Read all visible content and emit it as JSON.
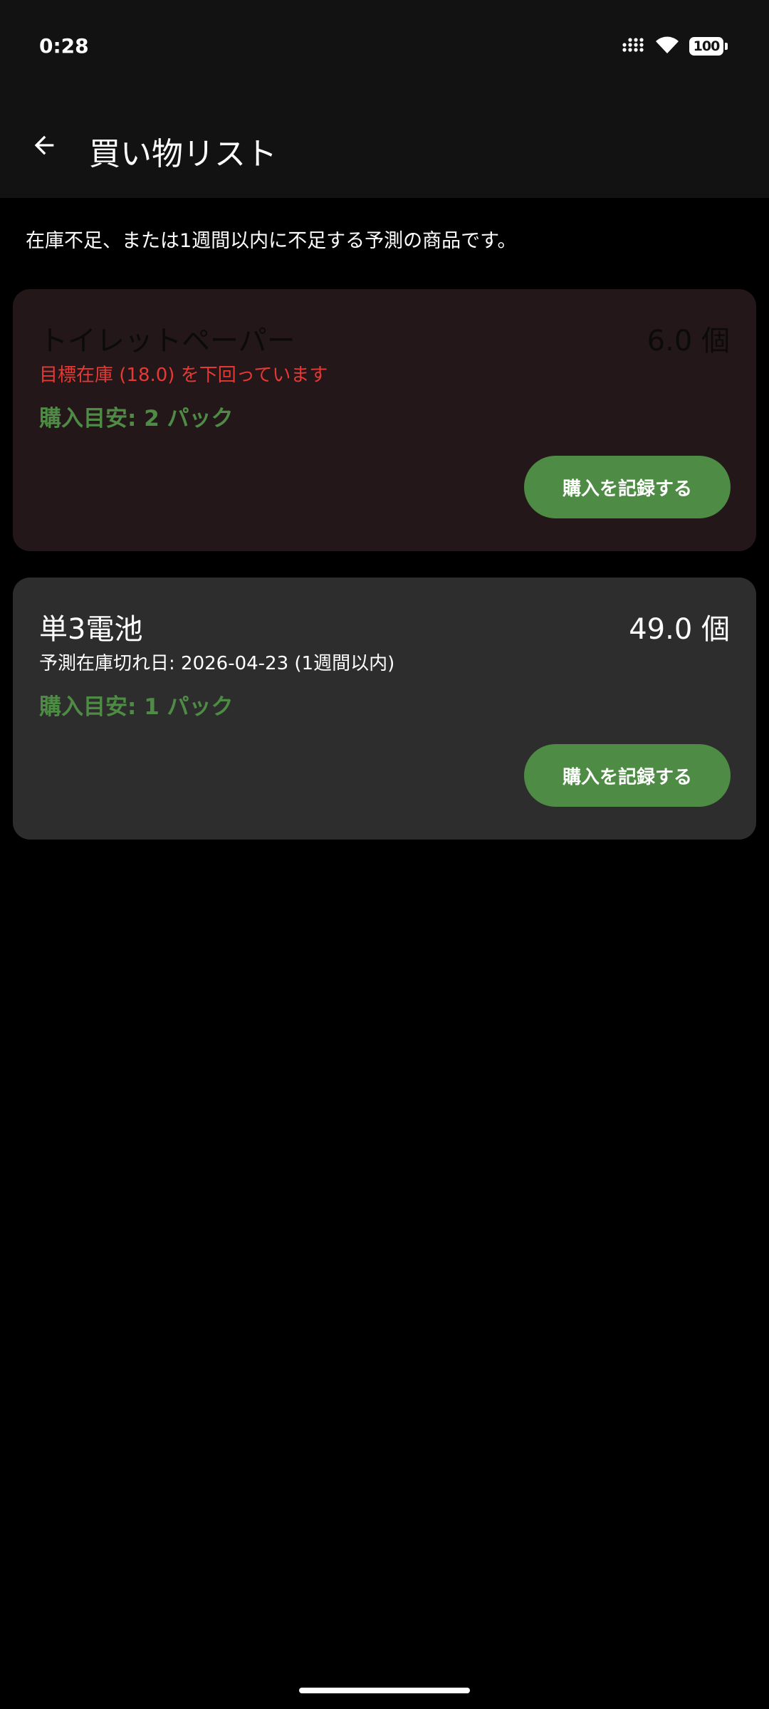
{
  "status_bar": {
    "time": "0:28",
    "battery": "100",
    "icons": [
      "signal-icon",
      "wifi-icon",
      "battery-icon"
    ]
  },
  "app_bar": {
    "title": "買い物リスト",
    "back_icon": "arrow-back-icon"
  },
  "description": "在庫不足、または1週間以内に不足する予測の商品です。",
  "items": [
    {
      "name": "トイレットペーパー",
      "quantity": "6.0 個",
      "note": "目標在庫 (18.0) を下回っています",
      "suggestion": "購入目安: 2 パック",
      "button": "購入を記録する"
    },
    {
      "name": "単3電池",
      "quantity": "49.0 個",
      "note": "予測在庫切れ日: 2026-04-23 (1週間以内)",
      "suggestion": "購入目安: 1 パック",
      "button": "購入を記録する"
    }
  ],
  "colors": {
    "accent_green": "#4e8b44",
    "warning_red": "#e53935",
    "card_warning_bg": "#231719",
    "card_normal_bg": "#2d2d2d",
    "bar_bg": "#121212"
  }
}
